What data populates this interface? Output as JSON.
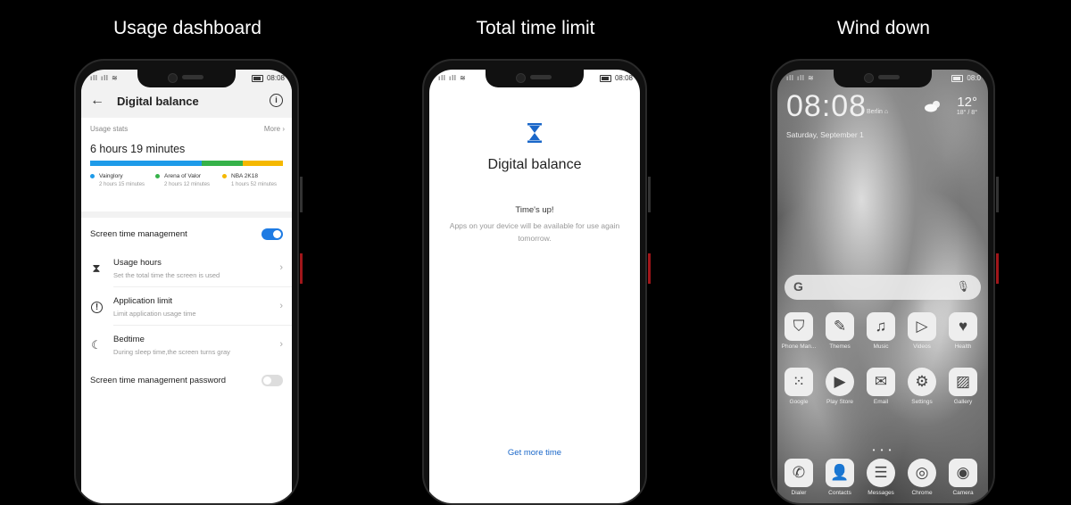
{
  "titles": [
    "Usage dashboard",
    "Total time limit",
    "Wind down"
  ],
  "phone1": {
    "status_time": "08:08",
    "header": {
      "back_icon": "arrow-left-icon",
      "title": "Digital balance",
      "info_icon": "info-icon"
    },
    "usage": {
      "label": "Usage stats",
      "more": "More",
      "total": "6 hours 19 minutes",
      "apps": [
        {
          "name": "Vainglory",
          "time": "2 hours 15 minutes",
          "color": "#1e9be9",
          "share": 0.58
        },
        {
          "name": "Arena of Valor",
          "time": "2 hours 12 minutes",
          "color": "#36b24a",
          "share": 0.21
        },
        {
          "name": "NBA 2K18",
          "time": "1 hours 52 minutes",
          "color": "#f5b800",
          "share": 0.21
        }
      ]
    },
    "screen_time_management": {
      "label": "Screen time management",
      "enabled": true
    },
    "items": [
      {
        "label": "Usage hours",
        "desc": "Set the total time the screen is used",
        "icon": "hourglass-icon"
      },
      {
        "label": "Application limit",
        "desc": "Limit application usage time",
        "icon": "alert-circle-icon"
      },
      {
        "label": "Bedtime",
        "desc": "During sleep time,the screen turns gray",
        "icon": "moon-icon"
      }
    ],
    "password": {
      "label": "Screen time management password",
      "enabled": false
    }
  },
  "phone2": {
    "status_time": "08:08",
    "icon": "hourglass-icon",
    "title": "Digital balance",
    "times_up": "Time's up!",
    "message": "Apps on your device will be available for use again tomorrow.",
    "action": "Get more time",
    "accent": "#1a67c9"
  },
  "phone3": {
    "status_time": "08:0",
    "clock": "08:08",
    "city": "Berlin",
    "date": "Saturday, September 1",
    "temp": "12°",
    "range": "18° / 8°",
    "apps_row1": [
      {
        "name": "Phone Man...",
        "icon": "shield-icon",
        "glyph": "⛉"
      },
      {
        "name": "Themes",
        "icon": "paintbrush-icon",
        "glyph": "✎"
      },
      {
        "name": "Music",
        "icon": "music-icon",
        "glyph": "♫"
      },
      {
        "name": "Videos",
        "icon": "play-icon",
        "glyph": "▷"
      },
      {
        "name": "Health",
        "icon": "heart-icon",
        "glyph": "♥"
      }
    ],
    "apps_row2": [
      {
        "name": "Google",
        "icon": "google-folder-icon",
        "glyph": "⁙"
      },
      {
        "name": "Play Store",
        "icon": "play-store-icon",
        "glyph": "▶"
      },
      {
        "name": "Email",
        "icon": "mail-icon",
        "glyph": "✉"
      },
      {
        "name": "Settings",
        "icon": "gear-icon",
        "glyph": "⚙"
      },
      {
        "name": "Gallery",
        "icon": "gallery-icon",
        "glyph": "▨"
      }
    ],
    "dock": [
      {
        "name": "Dialer",
        "icon": "phone-icon",
        "glyph": "✆"
      },
      {
        "name": "Contacts",
        "icon": "person-icon",
        "glyph": "👤"
      },
      {
        "name": "Messages",
        "icon": "chat-icon",
        "glyph": "☰"
      },
      {
        "name": "Chrome",
        "icon": "chrome-icon",
        "glyph": "◎"
      },
      {
        "name": "Camera",
        "icon": "camera-icon",
        "glyph": "◉"
      }
    ]
  }
}
